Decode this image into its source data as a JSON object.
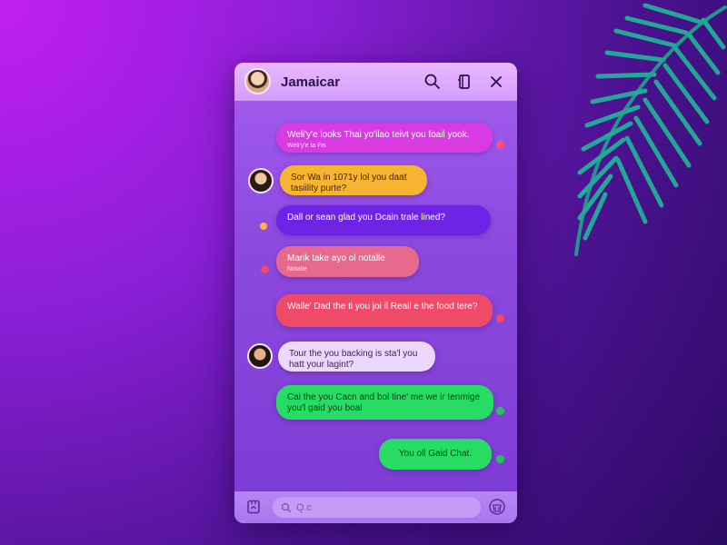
{
  "header": {
    "title": "Jamaicar"
  },
  "messages": [
    {
      "text": "Weli'y'e looks Thai yo'ilao teivt you foail yook.",
      "sub": "Weli'y'e ta Fis"
    },
    {
      "text": "Sor Wa in 1071y lol you daat tasiility purte?",
      "sub": ""
    },
    {
      "text": "Dall or sean glad you Dcain trale lined?",
      "sub": ""
    },
    {
      "text": "Marik take ayo ol notalle",
      "sub": "Notalle"
    },
    {
      "text": "Walle' Dad the ti you joi il Reail e the food tere?",
      "sub": ""
    },
    {
      "text": "Tour the you backing is sta'l you hatt your lagint?",
      "sub": ""
    },
    {
      "text": "Cai the you Cacn and bol tine' me we ir tenmige you'l gaid you boal",
      "sub": ""
    },
    {
      "text": "You oll Gaid Chat.",
      "sub": ""
    }
  ],
  "composer": {
    "placeholder": "Q.c"
  },
  "colors": {
    "magenta": "#d93be2",
    "yellow": "#f6b432",
    "purple": "#6f24e5",
    "pink": "#e7698d",
    "red": "#ef4a68",
    "lavender": "#ecd7ff",
    "green": "#28dc63",
    "header": "#dba7ff"
  },
  "icons": {
    "search": "search-icon",
    "device": "phone-book-icon",
    "close": "close-icon",
    "attach": "attachment-icon",
    "emoji": "emoji-icon"
  }
}
